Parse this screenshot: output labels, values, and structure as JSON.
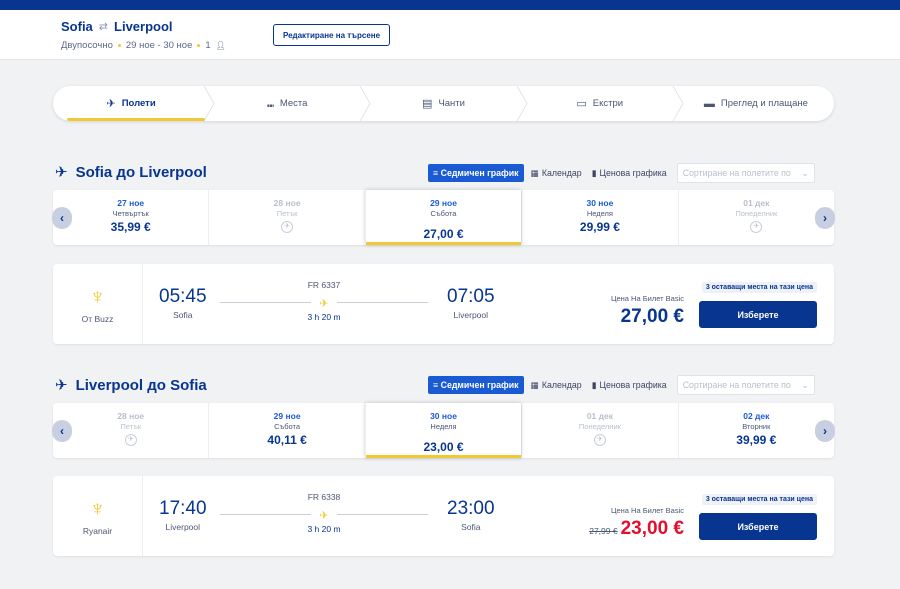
{
  "header": {
    "from": "Sofia",
    "to": "Liverpool",
    "roundtrip_icon": "roundtrip-arrows-icon",
    "trip_type": "Двупосочно",
    "dates": "29 ное - 30 ное",
    "passengers": "1",
    "edit_label": "Редактиране на търсене"
  },
  "steps": [
    {
      "label": "Полети",
      "icon": "plane-icon"
    },
    {
      "label": "Места",
      "icon": "seat-icon"
    },
    {
      "label": "Чанти",
      "icon": "bag-icon"
    },
    {
      "label": "Екстри",
      "icon": "extras-icon"
    },
    {
      "label": "Преглед и плащане",
      "icon": "card-icon"
    }
  ],
  "toolbar": {
    "weekly": "Седмичен график",
    "calendar": "Календар",
    "price_chart": "Ценова графика",
    "sort_placeholder": "Сортиране на полетите по"
  },
  "outbound": {
    "title": "Sofia до Liverpool",
    "dates": [
      {
        "date": "27 ное",
        "weekday": "Четвъртък",
        "price": "35,99 €",
        "available": true
      },
      {
        "date": "28 ное",
        "weekday": "Петък",
        "price": "",
        "available": false
      },
      {
        "date": "29 ное",
        "weekday": "Събота",
        "price": "27,00 €",
        "available": true,
        "selected": true
      },
      {
        "date": "30 ное",
        "weekday": "Неделя",
        "price": "29,99 €",
        "available": true
      },
      {
        "date": "01 дек",
        "weekday": "Понеделник",
        "price": "",
        "available": false
      }
    ],
    "flight": {
      "carrier": "От Buzz",
      "dep_time": "05:45",
      "dep_city": "Sofia",
      "flight_no": "FR 6337",
      "duration": "3 h 20 m",
      "arr_time": "07:05",
      "arr_city": "Liverpool",
      "price_label": "Цена На Билет Basic",
      "price": "27,00 €",
      "seats_left": "3 оставащи места на тази цена",
      "select_label": "Изберете"
    }
  },
  "inbound": {
    "title": "Liverpool до Sofia",
    "dates": [
      {
        "date": "28 ное",
        "weekday": "Петък",
        "price": "",
        "available": false
      },
      {
        "date": "29 ное",
        "weekday": "Събота",
        "price": "40,11 €",
        "available": true
      },
      {
        "date": "30 ное",
        "weekday": "Неделя",
        "price": "23,00 €",
        "available": true,
        "selected": true
      },
      {
        "date": "01 дек",
        "weekday": "Понеделник",
        "price": "",
        "available": false
      },
      {
        "date": "02 дек",
        "weekday": "Вторник",
        "price": "39,99 €",
        "available": true
      }
    ],
    "flight": {
      "carrier": "Ryanair",
      "dep_time": "17:40",
      "dep_city": "Liverpool",
      "flight_no": "FR 6338",
      "duration": "3 h 20 m",
      "arr_time": "23:00",
      "arr_city": "Sofia",
      "price_label": "Цена На Билет Basic",
      "old_price": "27,99 €",
      "price": "23,00 €",
      "seats_left": "3 оставащи места на тази цена",
      "select_label": "Изберете"
    }
  },
  "colors": {
    "brand": "#073590",
    "accent": "#f1c933",
    "sale": "#e40e2c",
    "link": "#1a5bd4"
  }
}
